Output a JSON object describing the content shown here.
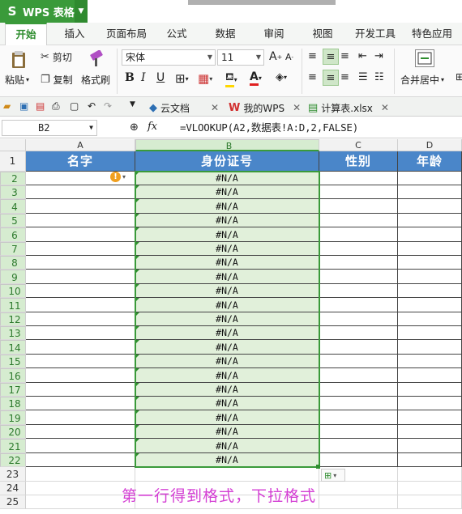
{
  "app": {
    "title": "WPS 表格",
    "logo": "S"
  },
  "menu_tabs": [
    "开始",
    "插入",
    "页面布局",
    "公式",
    "数据",
    "审阅",
    "视图",
    "开发工具",
    "特色应用"
  ],
  "ribbon": {
    "paste": "粘贴",
    "cut": "剪切",
    "copy": "复制",
    "format_painter": "格式刷",
    "font_name": "宋体",
    "font_size": "11",
    "bold": "B",
    "italic": "I",
    "underline": "U",
    "merge_center": "合并居中"
  },
  "doc_tabs": [
    "云文档",
    "我的WPS",
    "计算表.xlsx"
  ],
  "formula_bar": {
    "name_box": "B2",
    "fx": "fx",
    "formula": "=VLOOKUP(A2,数据表!A:D,2,FALSE)"
  },
  "columns": [
    "A",
    "B",
    "C",
    "D"
  ],
  "rows": [
    "1",
    "2",
    "3",
    "4",
    "5",
    "6",
    "7",
    "8",
    "9",
    "10",
    "11",
    "12",
    "13",
    "14",
    "15",
    "16",
    "17",
    "18",
    "19",
    "20",
    "21",
    "22",
    "23",
    "24",
    "25"
  ],
  "header_row": [
    "名字",
    "身份证号",
    "性别",
    "年龄"
  ],
  "b_values": [
    "#N/A",
    "#N/A",
    "#N/A",
    "#N/A",
    "#N/A",
    "#N/A",
    "#N/A",
    "#N/A",
    "#N/A",
    "#N/A",
    "#N/A",
    "#N/A",
    "#N/A",
    "#N/A",
    "#N/A",
    "#N/A",
    "#N/A",
    "#N/A",
    "#N/A",
    "#N/A",
    "#N/A"
  ],
  "annotation": "第一行得到格式，下拉格式",
  "colors": {
    "accent": "#3a9a3a",
    "header_fill": "#4a86c9",
    "selection_fill": "#e1f0da",
    "annotation": "#d43fd4"
  }
}
